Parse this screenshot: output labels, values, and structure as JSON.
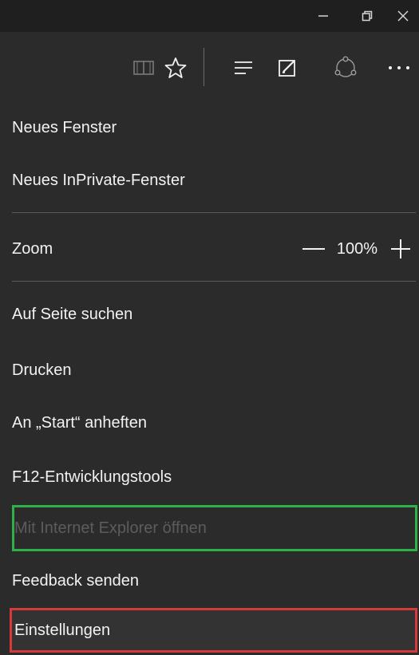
{
  "window": {
    "minimize_icon": "minimize-icon",
    "maximize_icon": "restore-icon",
    "close_icon": "close-icon"
  },
  "toolbar": {
    "icons": [
      "reading-view-icon",
      "favorite-star-icon",
      "hub-icon",
      "web-note-icon",
      "share-icon",
      "more-icon"
    ]
  },
  "menu": {
    "new_window": "Neues Fenster",
    "new_private_window": "Neues InPrivate-Fenster",
    "zoom_label": "Zoom",
    "zoom_value": "100%",
    "find_on_page": "Auf Seite suchen",
    "print": "Drucken",
    "pin_to_start": "An „Start“ anheften",
    "dev_tools": "F12-Entwicklungstools",
    "open_with_ie": "Mit Internet Explorer öffnen",
    "send_feedback": "Feedback senden",
    "settings": "Einstellungen"
  },
  "colors": {
    "background": "#2b2b2b",
    "titlebar": "#1f1f1f",
    "highlight_green": "#2fb14a",
    "highlight_red": "#d43a3a"
  }
}
